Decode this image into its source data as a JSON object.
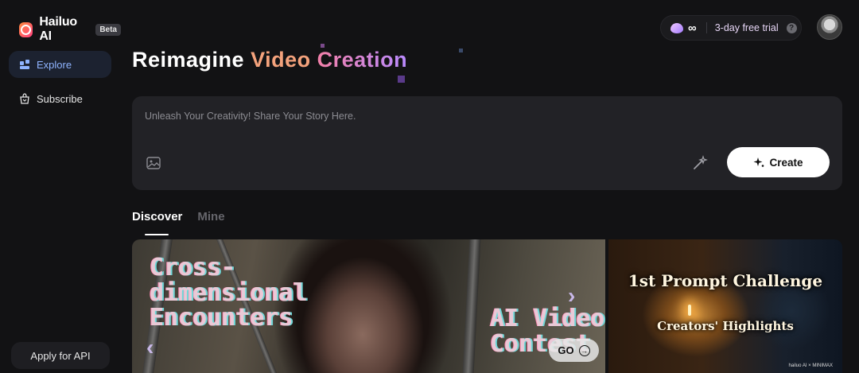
{
  "brand": {
    "name": "Hailuo AI",
    "badge": "Beta"
  },
  "sidebar": {
    "items": [
      {
        "label": "Explore",
        "icon": "explore-icon",
        "active": true
      },
      {
        "label": "Subscribe",
        "icon": "subscribe-icon",
        "active": false
      }
    ],
    "api_button": "Apply for API"
  },
  "header": {
    "trial": {
      "credits": "∞",
      "label": "3-day free trial",
      "help": "?"
    }
  },
  "hero": {
    "title_part1": "Reimagine",
    "title_part2": "Video",
    "title_part3": "Creation"
  },
  "prompt": {
    "placeholder": "Unleash Your Creativity! Share Your Story Here.",
    "value": "",
    "create_label": "Create"
  },
  "tabs": [
    {
      "label": "Discover",
      "active": true
    },
    {
      "label": "Mine",
      "active": false
    }
  ],
  "banners": {
    "main": {
      "title_lines": [
        "Cross-",
        "dimensional",
        "Encounters"
      ],
      "subtitle_lines": [
        "AI Video",
        "Contest"
      ],
      "go_label": "GO"
    },
    "side": {
      "title": "1st Prompt Challenge",
      "subtitle": "Creators' Highlights",
      "footer": "hailuo AI × MINIMAX"
    }
  },
  "colors": {
    "accent_active": "#8fb4ff",
    "title_orange": "#f4a27c",
    "title_pink": "#e67fbf",
    "background": "#121214"
  }
}
